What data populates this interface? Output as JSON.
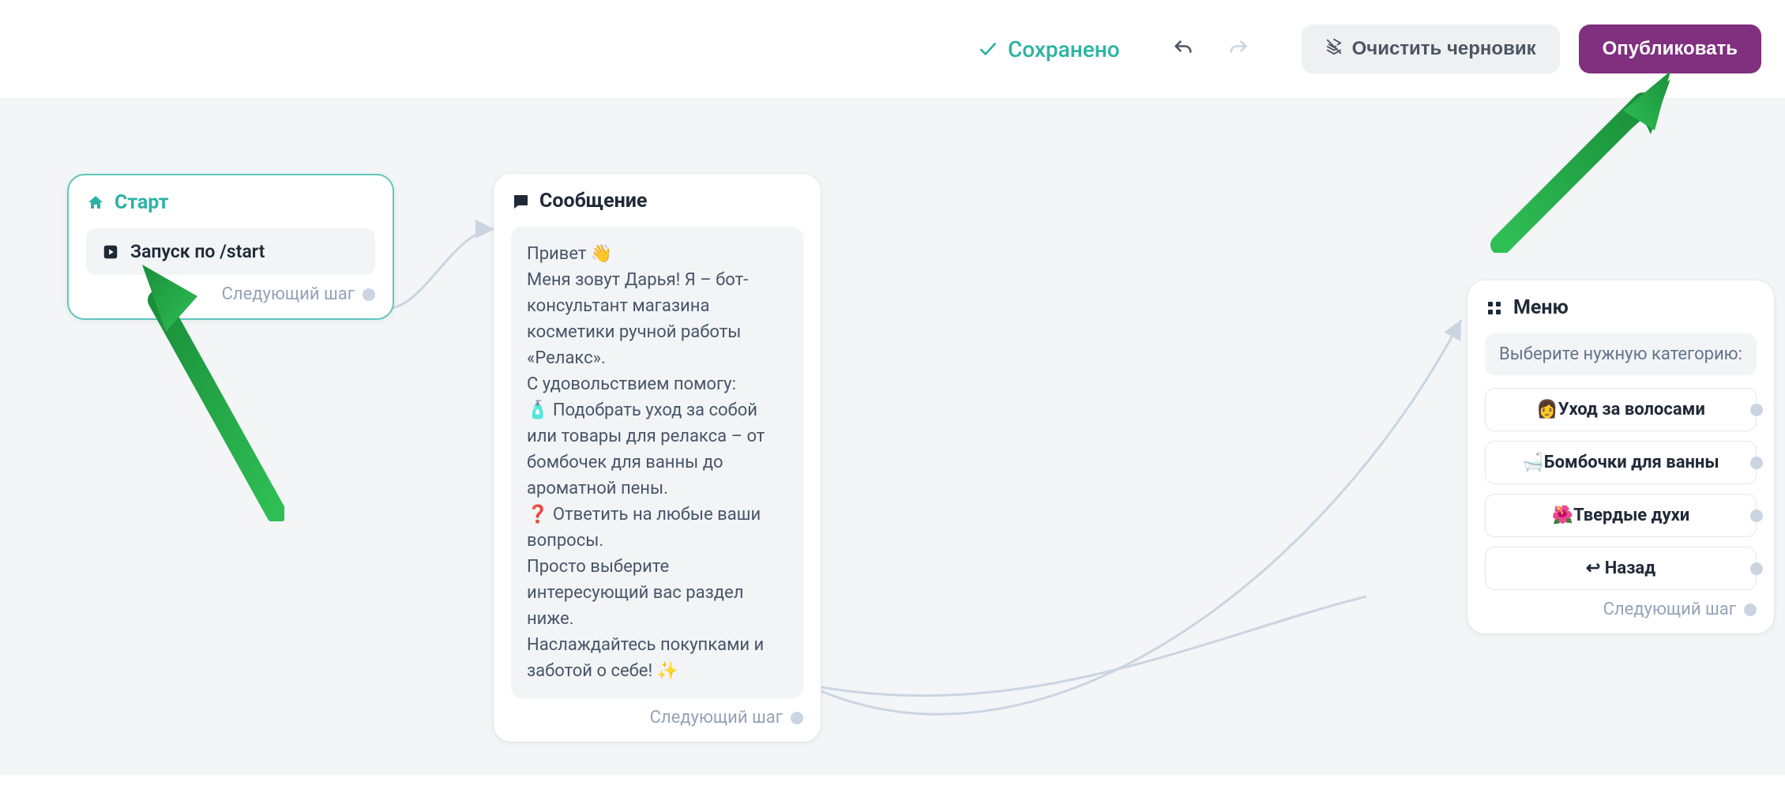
{
  "topbar": {
    "saved_label": "Сохранено",
    "clear_draft_label": "Очистить черновик",
    "publish_label": "Опубликовать"
  },
  "start": {
    "title": "Старт",
    "trigger_label": "Запуск по /start",
    "next_step_label": "Следующий шаг"
  },
  "message": {
    "title": "Сообщение",
    "body": "Привет 👋\nМеня зовут Дарья! Я – бот-консультант магазина косметики ручной работы «Релакс».\nС удовольствием помогу:\n🧴 Подобрать уход за собой или товары для релакса – от бомбочек для ванны до ароматной пены.\n❓ Ответить на любые ваши вопросы.\nПросто выберите интересующий вас раздел ниже.\nНаслаждайтесь покупками и заботой о себе! ✨",
    "next_step_label": "Следующий шаг"
  },
  "menu": {
    "title": "Меню",
    "category_prompt": "Выберите нужную категорию:",
    "options": [
      {
        "label": "👩Уход за волосами"
      },
      {
        "label": "🛁Бомбочки для ванны"
      },
      {
        "label": "🌺Твердые духи"
      },
      {
        "label": "↩ Назад"
      }
    ],
    "next_step_label": "Следующий шаг"
  },
  "colors": {
    "accent_teal": "#2bb3a3",
    "accent_purple": "#80307e",
    "canvas_bg": "#f3f5f7",
    "node_text": "#1f2937"
  }
}
